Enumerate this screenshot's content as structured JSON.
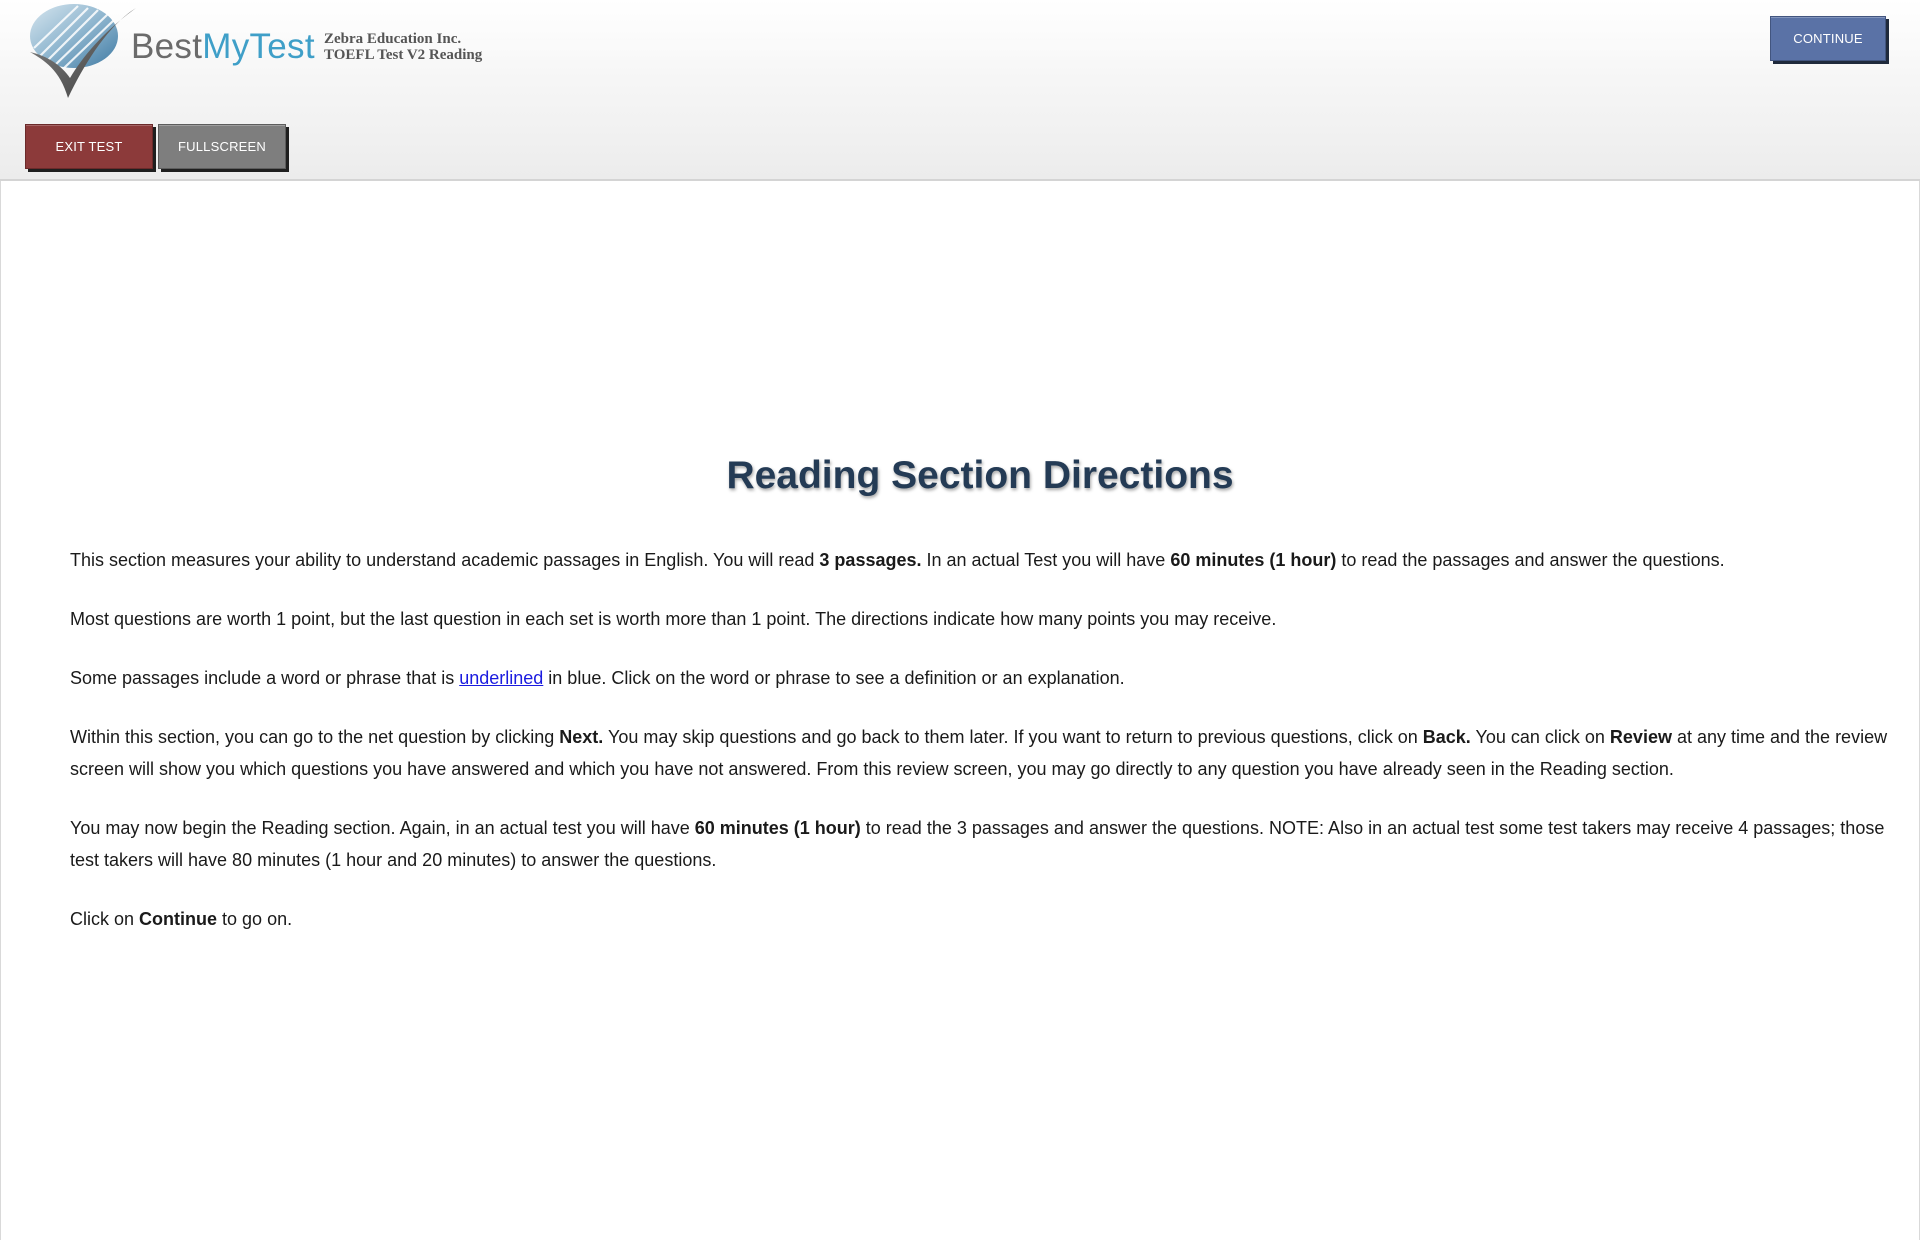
{
  "header": {
    "logo": {
      "name_part1": "Best",
      "name_part2": "MyTest"
    },
    "org_name": "Zebra Education Inc.",
    "test_name": "TOEFL Test V2 Reading",
    "continue_label": "CONTINUE",
    "exit_label": "EXIT TEST",
    "fullscreen_label": "FULLSCREEN"
  },
  "colors": {
    "continue_button": "#5a72a6",
    "exit_button": "#8c3a3a",
    "fullscreen_button": "#7e7e7e",
    "title": "#243b55",
    "link": "#1a1adf",
    "logo_accent": "#3f9fc8"
  },
  "main": {
    "title": "Reading Section Directions",
    "p1": {
      "t1": "This section measures your ability to understand academic passages in English. You will read ",
      "b1": "3 passages.",
      "t2": " In an actual Test you will have ",
      "b2": "60 minutes (1 hour)",
      "t3": " to read the passages and answer the questions."
    },
    "p2": {
      "t1": "Most questions are worth 1 point, but the last question in each set is worth more than 1 point. The directions indicate how many points you may receive."
    },
    "p3": {
      "t1": "Some passages include a word or phrase that is ",
      "link": "underlined",
      "t2": " in blue. Click on the word or phrase to see a definition or an explanation."
    },
    "p4": {
      "t1": "Within this section, you can go to the net question by clicking ",
      "b1": "Next.",
      "t2": " You may skip questions and go back to them later. If you want to return to previous questions, click on ",
      "b2": "Back.",
      "t3": " You can click on ",
      "b3": "Review",
      "t4": " at any time and the review screen will show you which questions you have answered and which you have not answered. From this review screen, you may go directly to any question you have already seen in the Reading section."
    },
    "p5": {
      "t1": "You may now begin the Reading section. Again, in an actual test you will have ",
      "b1": "60 minutes (1 hour)",
      "t2": " to read the 3 passages and answer the questions. NOTE: Also in an actual test some test takers may receive 4 passages; those test takers will have 80 minutes (1 hour and 20 minutes) to answer the questions."
    },
    "p6": {
      "t1": "Click on ",
      "b1": "Continue",
      "t2": " to go on."
    }
  }
}
